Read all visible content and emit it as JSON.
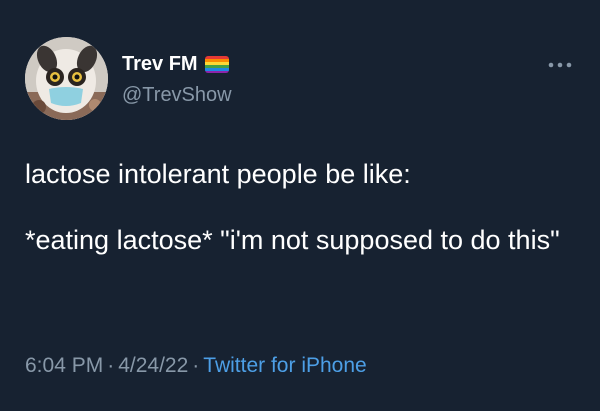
{
  "author": {
    "display_name": "Trev FM",
    "handle": "@TrevShow",
    "avatar_icon": "furby-avatar",
    "flag_icon": "rainbow-flag-icon"
  },
  "tweet": {
    "text_line1": "lactose intolerant people be like:",
    "text_line2": "*eating lactose* \"i'm not supposed to do this\""
  },
  "meta": {
    "time": "6:04 PM",
    "date": "4/24/22",
    "separator": "·",
    "source": "Twitter for iPhone"
  },
  "more_icon": "more-horizontal-icon",
  "colors": {
    "background": "#172231",
    "text": "#ffffff",
    "secondary": "#8898a8",
    "link": "#4d9fe6"
  }
}
